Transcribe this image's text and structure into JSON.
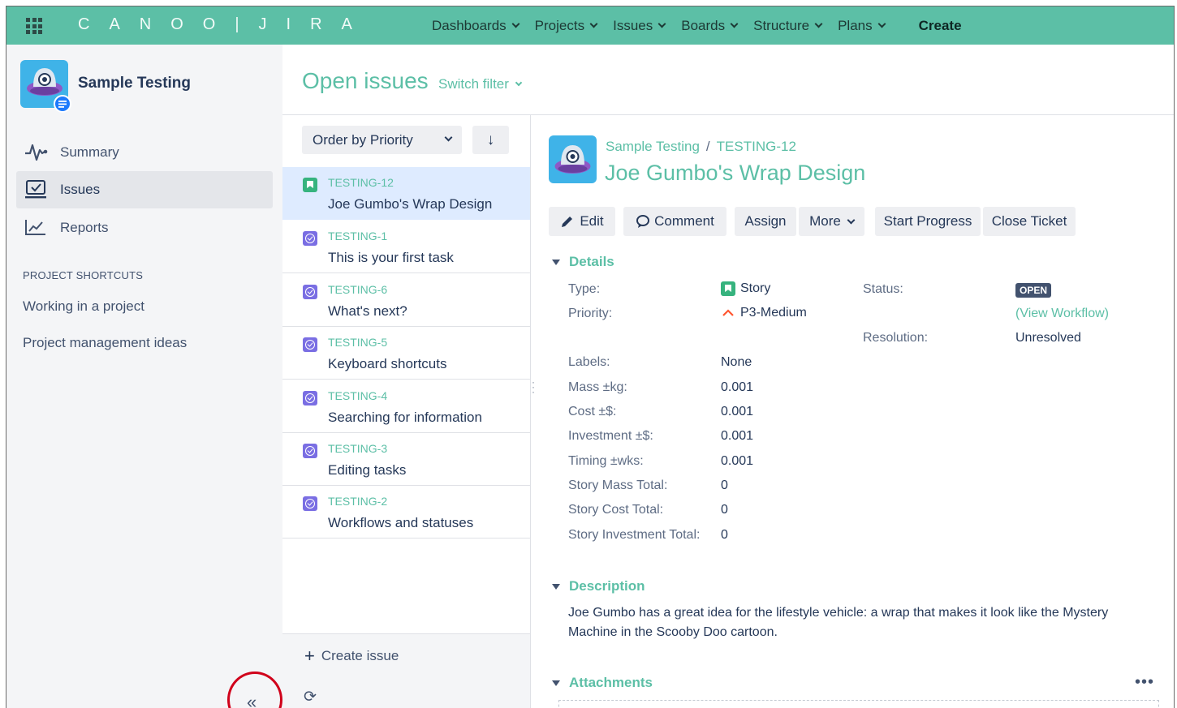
{
  "nav": {
    "logo": "CANOO|JIRA",
    "items": [
      "Dashboards",
      "Projects",
      "Issues",
      "Boards",
      "Structure",
      "Plans"
    ],
    "create": "Create"
  },
  "sidebar": {
    "project_name": "Sample Testing",
    "items": [
      {
        "label": "Summary",
        "icon": "activity-icon"
      },
      {
        "label": "Issues",
        "icon": "issues-icon",
        "active": true
      },
      {
        "label": "Reports",
        "icon": "reports-icon"
      }
    ],
    "shortcuts_heading": "PROJECT SHORTCUTS",
    "shortcuts": [
      "Working in a project",
      "Project management ideas"
    ],
    "collapse": "«"
  },
  "header": {
    "title": "Open issues",
    "switch_filter": "Switch filter"
  },
  "list": {
    "order_label": "Order by Priority",
    "sort_icon": "↓",
    "issues": [
      {
        "key": "TESTING-12",
        "summary": "Joe Gumbo's Wrap Design",
        "type": "story",
        "selected": true
      },
      {
        "key": "TESTING-1",
        "summary": "This is your first task",
        "type": "task"
      },
      {
        "key": "TESTING-6",
        "summary": "What's next?",
        "type": "task"
      },
      {
        "key": "TESTING-5",
        "summary": "Keyboard shortcuts",
        "type": "task"
      },
      {
        "key": "TESTING-4",
        "summary": "Searching for information",
        "type": "task"
      },
      {
        "key": "TESTING-3",
        "summary": "Editing tasks",
        "type": "task"
      },
      {
        "key": "TESTING-2",
        "summary": "Workflows and statuses",
        "type": "task"
      }
    ],
    "create_issue": "Create issue",
    "refresh_icon": "⟳"
  },
  "detail": {
    "breadcrumb_project": "Sample Testing",
    "breadcrumb_sep": "/",
    "breadcrumb_key": "TESTING-12",
    "title": "Joe Gumbo's Wrap Design",
    "actions": {
      "edit": "Edit",
      "comment": "Comment",
      "assign": "Assign",
      "more": "More",
      "start_progress": "Start Progress",
      "close_ticket": "Close Ticket"
    },
    "details_heading": "Details",
    "fields": {
      "type_label": "Type:",
      "type_value": "Story",
      "priority_label": "Priority:",
      "priority_value": "P3-Medium",
      "status_label": "Status:",
      "status_value": "OPEN",
      "view_workflow": "(View Workflow)",
      "resolution_label": "Resolution:",
      "resolution_value": "Unresolved",
      "labels_label": "Labels:",
      "labels_value": "None",
      "mass_label": "Mass ±kg:",
      "mass_value": "0.001",
      "cost_label": "Cost ±$:",
      "cost_value": "0.001",
      "investment_label": "Investment ±$:",
      "investment_value": "0.001",
      "timing_label": "Timing ±wks:",
      "timing_value": "0.001",
      "story_mass_label": "Story Mass Total:",
      "story_mass_value": "0",
      "story_cost_label": "Story Cost Total:",
      "story_cost_value": "0",
      "story_invest_label": "Story Investment Total:",
      "story_invest_value": "0"
    },
    "description_heading": "Description",
    "description": "Joe Gumbo has a great idea for the lifestyle vehicle: a wrap that makes it look like the Mystery Machine in the Scooby Doo cartoon.",
    "attachments_heading": "Attachments",
    "more_dots": "•••"
  },
  "colors": {
    "nav_bg": "#5cbfa6",
    "accent": "#5cbfa6",
    "selected_row": "#deebff",
    "status_lozenge": "#42526e",
    "annotation_circle": "#d0021b"
  }
}
